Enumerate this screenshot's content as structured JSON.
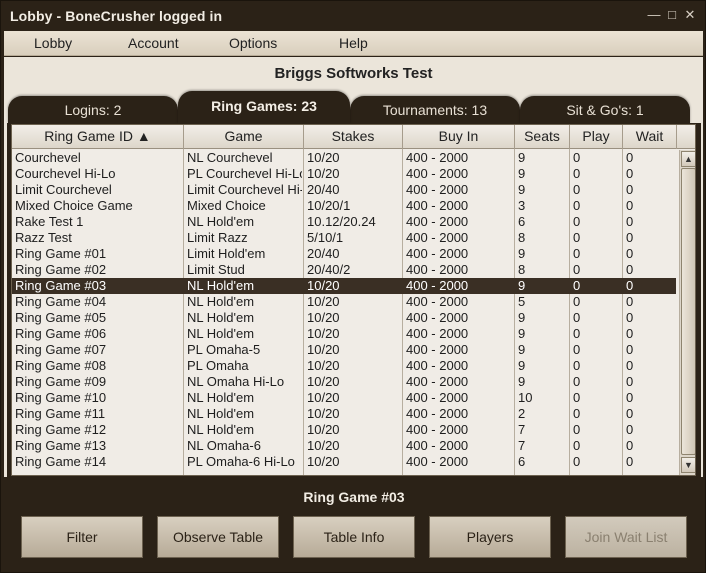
{
  "window": {
    "title": "Lobby - BoneCrusher logged in",
    "controls": {
      "minimize": "—",
      "maximize": "□",
      "close": "✕"
    }
  },
  "menu": {
    "lobby": "Lobby",
    "account": "Account",
    "options": "Options",
    "help": "Help"
  },
  "app_title": "Briggs Softworks Test",
  "tabs": {
    "logins": "Logins: 2",
    "ring_games": "Ring Games: 23",
    "tournaments": "Tournaments: 13",
    "sit_and_go": "Sit & Go's: 1",
    "active": "ring_games"
  },
  "table": {
    "headers": {
      "id": "Ring Game ID ▲",
      "game": "Game",
      "stakes": "Stakes",
      "buyin": "Buy In",
      "seats": "Seats",
      "play": "Play",
      "wait": "Wait"
    },
    "selected_index": 8,
    "rows": [
      {
        "id": "Courchevel",
        "game": "NL Courchevel",
        "stakes": "10/20",
        "buyin": "400 - 2000",
        "seats": "9",
        "play": "0",
        "wait": "0"
      },
      {
        "id": "Courchevel Hi-Lo",
        "game": "PL Courchevel Hi-Lo",
        "stakes": "10/20",
        "buyin": "400 - 2000",
        "seats": "9",
        "play": "0",
        "wait": "0"
      },
      {
        "id": "Limit Courchevel",
        "game": "Limit Courchevel Hi-Lo",
        "stakes": "20/40",
        "buyin": "400 - 2000",
        "seats": "9",
        "play": "0",
        "wait": "0"
      },
      {
        "id": "Mixed Choice Game",
        "game": "Mixed Choice",
        "stakes": "10/20/1",
        "buyin": "400 - 2000",
        "seats": "3",
        "play": "0",
        "wait": "0"
      },
      {
        "id": "Rake Test 1",
        "game": "NL Hold'em",
        "stakes": "10.12/20.24",
        "buyin": "400 - 2000",
        "seats": "6",
        "play": "0",
        "wait": "0"
      },
      {
        "id": "Razz Test",
        "game": "Limit Razz",
        "stakes": "5/10/1",
        "buyin": "400 - 2000",
        "seats": "8",
        "play": "0",
        "wait": "0"
      },
      {
        "id": "Ring Game #01",
        "game": "Limit Hold'em",
        "stakes": "20/40",
        "buyin": "400 - 2000",
        "seats": "9",
        "play": "0",
        "wait": "0"
      },
      {
        "id": "Ring Game #02",
        "game": "Limit Stud",
        "stakes": "20/40/2",
        "buyin": "400 - 2000",
        "seats": "8",
        "play": "0",
        "wait": "0"
      },
      {
        "id": "Ring Game #03",
        "game": "NL Hold'em",
        "stakes": "10/20",
        "buyin": "400 - 2000",
        "seats": "9",
        "play": "0",
        "wait": "0"
      },
      {
        "id": "Ring Game #04",
        "game": "NL Hold'em",
        "stakes": "10/20",
        "buyin": "400 - 2000",
        "seats": "5",
        "play": "0",
        "wait": "0"
      },
      {
        "id": "Ring Game #05",
        "game": "NL Hold'em",
        "stakes": "10/20",
        "buyin": "400 - 2000",
        "seats": "9",
        "play": "0",
        "wait": "0"
      },
      {
        "id": "Ring Game #06",
        "game": "NL Hold'em",
        "stakes": "10/20",
        "buyin": "400 - 2000",
        "seats": "9",
        "play": "0",
        "wait": "0"
      },
      {
        "id": "Ring Game #07",
        "game": "PL Omaha-5",
        "stakes": "10/20",
        "buyin": "400 - 2000",
        "seats": "9",
        "play": "0",
        "wait": "0"
      },
      {
        "id": "Ring Game #08",
        "game": "PL Omaha",
        "stakes": "10/20",
        "buyin": "400 - 2000",
        "seats": "9",
        "play": "0",
        "wait": "0"
      },
      {
        "id": "Ring Game #09",
        "game": "NL Omaha Hi-Lo",
        "stakes": "10/20",
        "buyin": "400 - 2000",
        "seats": "9",
        "play": "0",
        "wait": "0"
      },
      {
        "id": "Ring Game #10",
        "game": "NL Hold'em",
        "stakes": "10/20",
        "buyin": "400 - 2000",
        "seats": "10",
        "play": "0",
        "wait": "0"
      },
      {
        "id": "Ring Game #11",
        "game": "NL Hold'em",
        "stakes": "10/20",
        "buyin": "400 - 2000",
        "seats": "2",
        "play": "0",
        "wait": "0"
      },
      {
        "id": "Ring Game #12",
        "game": "NL Hold'em",
        "stakes": "10/20",
        "buyin": "400 - 2000",
        "seats": "7",
        "play": "0",
        "wait": "0"
      },
      {
        "id": "Ring Game #13",
        "game": "NL Omaha-6",
        "stakes": "10/20",
        "buyin": "400 - 2000",
        "seats": "7",
        "play": "0",
        "wait": "0"
      },
      {
        "id": "Ring Game #14",
        "game": "PL Omaha-6 Hi-Lo",
        "stakes": "10/20",
        "buyin": "400 - 2000",
        "seats": "6",
        "play": "0",
        "wait": "0"
      }
    ]
  },
  "scrollbar": {
    "up": "▲",
    "down": "▼"
  },
  "selected_game_label": "Ring Game #03",
  "buttons": {
    "filter": "Filter",
    "observe": "Observe Table",
    "table_info": "Table Info",
    "players": "Players",
    "join_wait": "Join Wait List"
  },
  "colors": {
    "frame": "#2b2217",
    "selection": "#3a2f24",
    "panel": "#ebe5da"
  }
}
